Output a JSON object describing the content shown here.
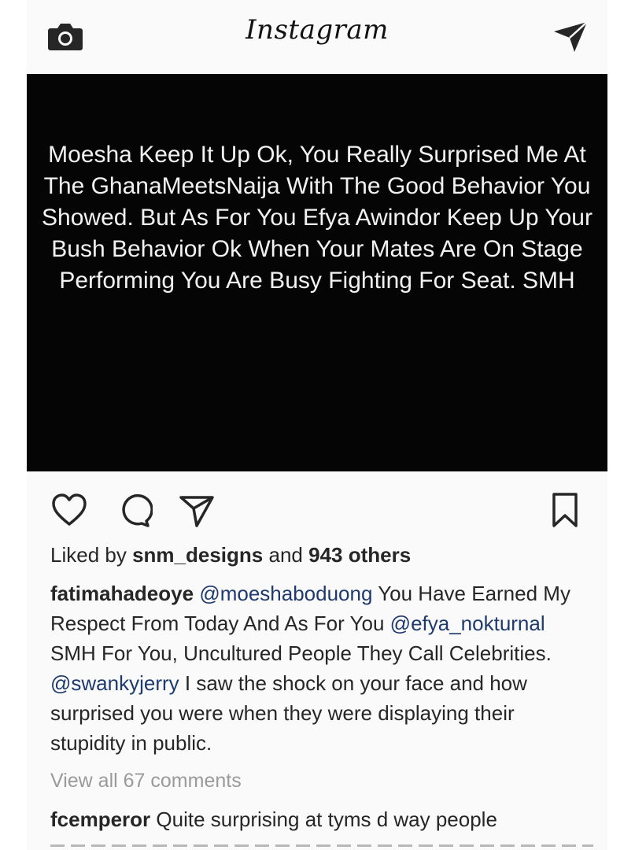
{
  "header": {
    "logo": "Instagram",
    "camera_icon": "camera-icon",
    "direct_icon": "paper-plane-icon"
  },
  "post": {
    "image_text": "Moesha Keep It Up Ok, You Really Surprised Me At The GhanaMeetsNaija With The Good Behavior You Showed. But As For You Efya Awindor Keep Up Your Bush Behavior Ok When Your Mates Are On Stage Performing You Are Busy Fighting For Seat. SMH",
    "image_background": "#050505"
  },
  "actions": {
    "like_icon": "heart-icon",
    "comment_icon": "comment-icon",
    "share_icon": "paper-plane-icon",
    "save_icon": "bookmark-icon"
  },
  "likes": {
    "prefix": "Liked by",
    "user": "snm_designs",
    "middle": "and",
    "others": "943 others"
  },
  "caption": {
    "username": "fatimahadeoye",
    "mention1": "@moeshaboduong",
    "text1": "You Have Earned My Respect From Today And As For You",
    "mention2": "@efya_nokturnal",
    "text2": "SMH For You, Uncultured People They Call Celebrities.",
    "mention3": "@swankyjerry",
    "text3": "I saw the shock on your face and how surprised you were when they were displaying their stupidity in public.",
    "mention_color": "#1e3a6e"
  },
  "comments": {
    "view_all": "View all 67 comments",
    "first_user": "fcemperor",
    "first_text": "Quite surprising at tyms d way people"
  }
}
